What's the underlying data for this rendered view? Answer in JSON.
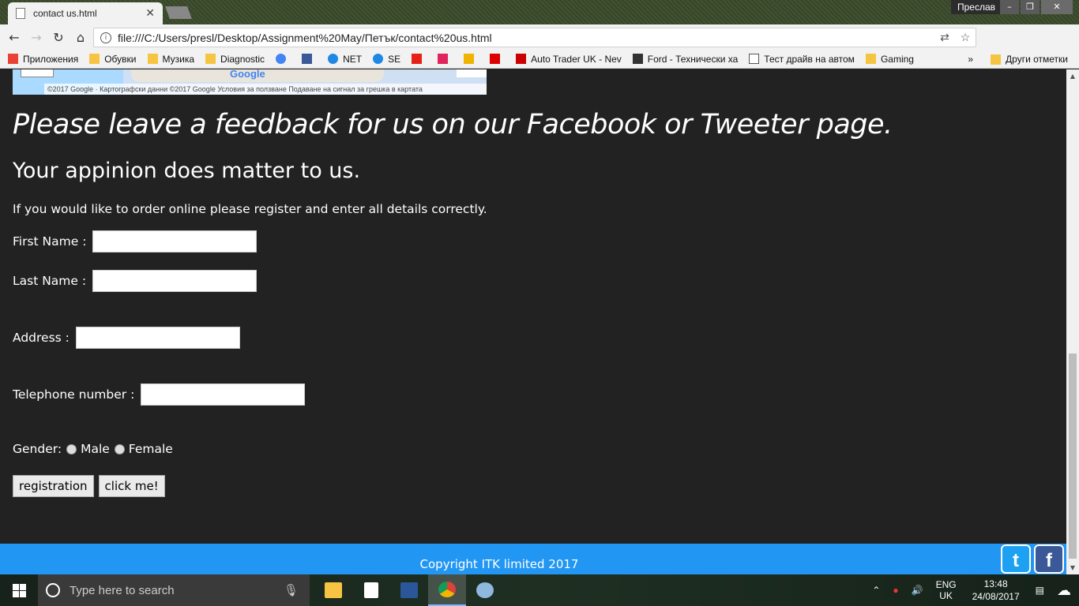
{
  "browser": {
    "tab_title": "contact us.html",
    "tab_close": "✕",
    "user_name": "Преслав",
    "url": "file:///C:/Users/presl/Desktop/Assignment%20May/Петък/contact%20us.html",
    "nav": {
      "back": "←",
      "forward": "→",
      "reload": "↻",
      "home": "⌂"
    }
  },
  "bookmarks": {
    "items": [
      {
        "label": "Приложения",
        "icon": "apps-grid-icon"
      },
      {
        "label": "Обувки",
        "icon": "folder-icon"
      },
      {
        "label": "Музика",
        "icon": "folder-icon"
      },
      {
        "label": "Diagnostic",
        "icon": "folder-icon"
      },
      {
        "label": "",
        "icon": "google-icon"
      },
      {
        "label": "",
        "icon": "facebook-icon"
      },
      {
        "label": "NET",
        "icon": "globe-icon"
      },
      {
        "label": "SE",
        "icon": "globe-icon"
      },
      {
        "label": "",
        "icon": "youtube-icon"
      },
      {
        "label": "",
        "icon": "seven-icon"
      },
      {
        "label": "",
        "icon": "grid-icon"
      },
      {
        "label": "",
        "icon": "red-cross-icon"
      },
      {
        "label": "Auto Trader UK - Nev",
        "icon": "autotrader-icon"
      },
      {
        "label": "Ford - Технически ха",
        "icon": "ford-icon"
      },
      {
        "label": "Тест драйв на автом",
        "icon": "page-icon"
      },
      {
        "label": "Gaming",
        "icon": "folder-icon"
      }
    ],
    "more": "»",
    "other": "Други отметки"
  },
  "map": {
    "logo": "Google",
    "footer": "©2017 Google · Картографски данни ©2017 Google    Условия за ползване    Подаване на сигнал за грешка в картата"
  },
  "page": {
    "feedback_heading": "Please leave a feedback for us on our Facebook or Tweeter page.",
    "opinion_heading": "Your appinion does matter to us.",
    "intro": "If you would like to order online please register and enter all details correctly.",
    "first_name_label": "First Name :",
    "last_name_label": "Last Name :",
    "address_label": "Address :",
    "telephone_label": "Telephone number :",
    "gender_label": "Gender:",
    "male_label": "Male",
    "female_label": "Female",
    "registration_button": "registration",
    "click_button": "click me!"
  },
  "footer": {
    "copyright": "Copyright ITK limited 2017",
    "twitter": "t",
    "facebook": "f"
  },
  "taskbar": {
    "search_placeholder": "Type here to search",
    "lang": "ENG",
    "lang_sub": "UK",
    "time": "13:48",
    "date": "24/08/2017"
  }
}
